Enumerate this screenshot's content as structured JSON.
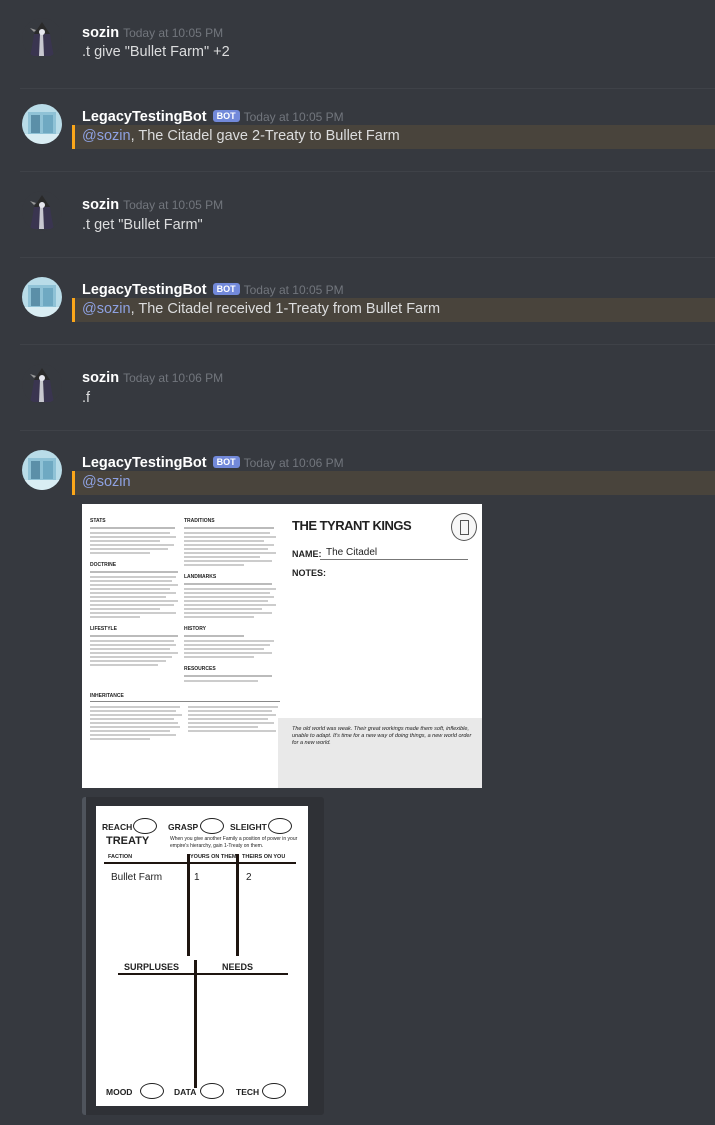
{
  "messages": [
    {
      "user": "sozin",
      "time": "Today at 10:05 PM",
      "text": ".t give \"Bullet Farm\" +2"
    },
    {
      "user": "LegacyTestingBot",
      "badge": "BOT",
      "time": "Today at 10:05 PM",
      "mention": "@sozin",
      "text": ", The Citadel gave 2-Treaty to Bullet Farm"
    },
    {
      "user": "sozin",
      "time": "Today at 10:05 PM",
      "text": ".t get \"Bullet Farm\""
    },
    {
      "user": "LegacyTestingBot",
      "badge": "BOT",
      "time": "Today at 10:05 PM",
      "mention": "@sozin",
      "text": ", The Citadel received 1-Treaty from Bullet Farm"
    },
    {
      "user": "sozin",
      "time": "Today at 10:06 PM",
      "text": ".f"
    },
    {
      "user": "LegacyTestingBot",
      "badge": "BOT",
      "time": "Today at 10:06 PM",
      "mention": "@sozin",
      "text": ""
    }
  ],
  "sheet": {
    "title": "THE TYRANT KINGS",
    "name_label": "NAME:",
    "name_value": "The Citadel",
    "notes_label": "NOTES:",
    "col1_heads": [
      "STATS",
      "DOCTRINE",
      "LIFESTYLE"
    ],
    "col2_heads": [
      "TRADITIONS",
      "LANDMARKS",
      "HISTORY",
      "RESOURCES"
    ],
    "inheritance": "INHERITANCE",
    "quote": "The old world was weak. Their great workings made them soft, inflexible, unable to adapt. It's time for a new way of doing things, a new world order for a new world."
  },
  "treaty": {
    "stats_top": [
      "REACH",
      "GRASP",
      "SLEIGHT"
    ],
    "title": "TREATY",
    "desc": "When you give another Family a position of power in your empire's hierarchy, gain 1-Treaty on them.",
    "columns": [
      "FACTION",
      "YOURS ON THEM",
      "THEIRS ON YOU"
    ],
    "rows": [
      {
        "faction": "Bullet Farm",
        "yours": "1",
        "theirs": "2"
      }
    ],
    "surpluses": "SURPLUSES",
    "needs": "NEEDS",
    "stats_bottom": [
      "MOOD",
      "DATA",
      "TECH"
    ]
  },
  "colors": {
    "background": "#36393f",
    "mention": "#8ea1e1",
    "mention_bg": "#49443c",
    "mention_bar": "#faa61a",
    "bot_badge": "#7289da"
  }
}
